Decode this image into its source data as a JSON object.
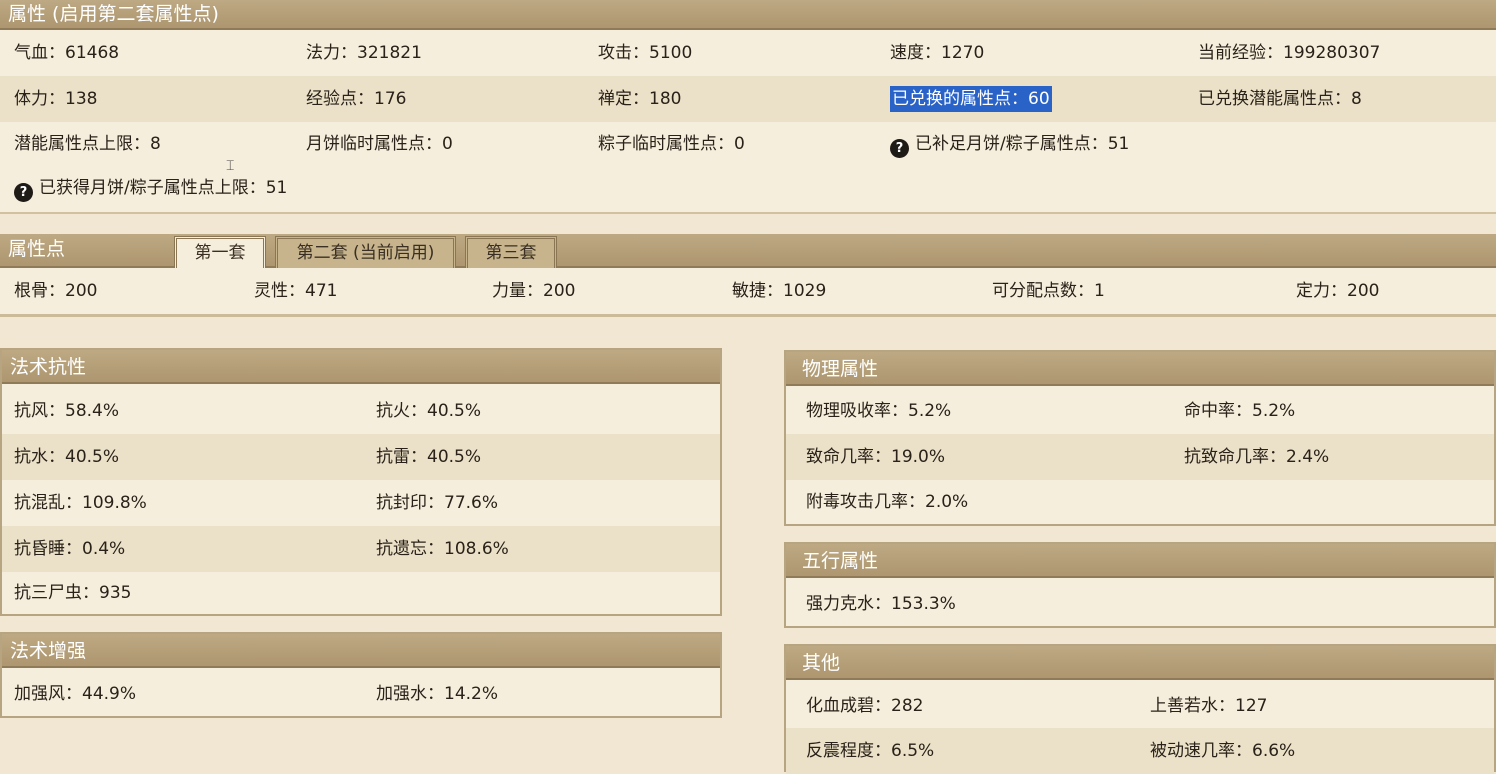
{
  "attr": {
    "title": "属性 (启用第二套属性点)",
    "rows": [
      [
        "气血：61468",
        "法力：321821",
        "攻击：5100",
        "速度：1270",
        "当前经验：199280307"
      ],
      [
        "体力：138",
        "经验点：176",
        "禅定：180",
        "已兑换的属性点：60",
        "已兑换潜能属性点：8"
      ],
      [
        "潜能属性点上限：8",
        "月饼临时属性点：0",
        "粽子临时属性点：0",
        "已补足月饼/粽子属性点：51"
      ],
      [
        "已获得月饼/粽子属性点上限：51"
      ]
    ]
  },
  "points": {
    "title": "属性点",
    "tabs": [
      "第一套",
      "第二套 (当前启用)",
      "第三套"
    ],
    "values": [
      "根骨：200",
      "灵性：471",
      "力量：200",
      "敏捷：1029",
      "可分配点数：1",
      "定力：200"
    ]
  },
  "magic_res": {
    "title": "法术抗性",
    "rows": [
      [
        "抗风：58.4%",
        "抗火：40.5%"
      ],
      [
        "抗水：40.5%",
        "抗雷：40.5%"
      ],
      [
        "抗混乱：109.8%",
        "抗封印：77.6%"
      ],
      [
        "抗昏睡：0.4%",
        "抗遗忘：108.6%"
      ],
      [
        "抗三尸虫：935"
      ]
    ]
  },
  "magic_boost": {
    "title": "法术增强",
    "rows": [
      [
        "加强风：44.9%",
        "加强水：14.2%"
      ]
    ]
  },
  "physical": {
    "title": "物理属性",
    "rows": [
      [
        "物理吸收率：5.2%",
        "命中率：5.2%"
      ],
      [
        "致命几率：19.0%",
        "抗致命几率：2.4%"
      ],
      [
        "附毒攻击几率：2.0%"
      ]
    ]
  },
  "elements": {
    "title": "五行属性",
    "rows": [
      [
        "强力克水：153.3%"
      ]
    ]
  },
  "other": {
    "title": "其他",
    "rows": [
      [
        "化血成碧：282",
        "上善若水：127"
      ],
      [
        "反震程度：6.5%",
        "被动速几率：6.6%"
      ]
    ]
  },
  "icons": {
    "help": "help-icon"
  }
}
